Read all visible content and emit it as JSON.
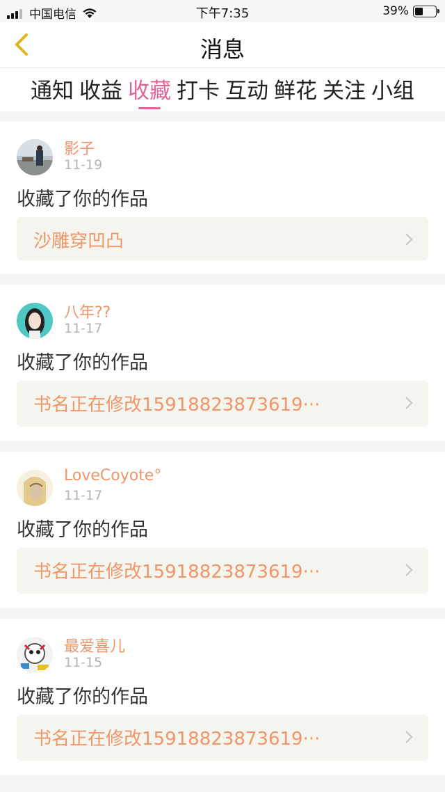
{
  "status_bar": {
    "carrier": "中国电信",
    "time": "下午7:35",
    "battery": "39%",
    "battery_level": 0.39
  },
  "nav": {
    "title": "消息"
  },
  "tabs": [
    {
      "label": "通知"
    },
    {
      "label": "收益"
    },
    {
      "label": "收藏",
      "active": true
    },
    {
      "label": "打卡"
    },
    {
      "label": "互动"
    },
    {
      "label": "鲜花"
    },
    {
      "label": "关注"
    },
    {
      "label": "小组"
    }
  ],
  "items": [
    {
      "user": "影子",
      "date": "11-19",
      "action": "收藏了你的作品",
      "work": "沙雕穿凹凸"
    },
    {
      "user": "八年??",
      "date": "11-17",
      "action": "收藏了你的作品",
      "work": "书名正在修改15918823873619···"
    },
    {
      "user": "LoveCoyote°",
      "date": "11-17",
      "action": "收藏了你的作品",
      "work": "书名正在修改15918823873619···"
    },
    {
      "user": "最爱喜儿",
      "date": "11-15",
      "action": "收藏了你的作品",
      "work": "书名正在修改15918823873619···"
    }
  ],
  "colors": {
    "accent_pink": "#e0639b",
    "name_orange": "#f0956a",
    "back_yellow": "#e2b321"
  }
}
